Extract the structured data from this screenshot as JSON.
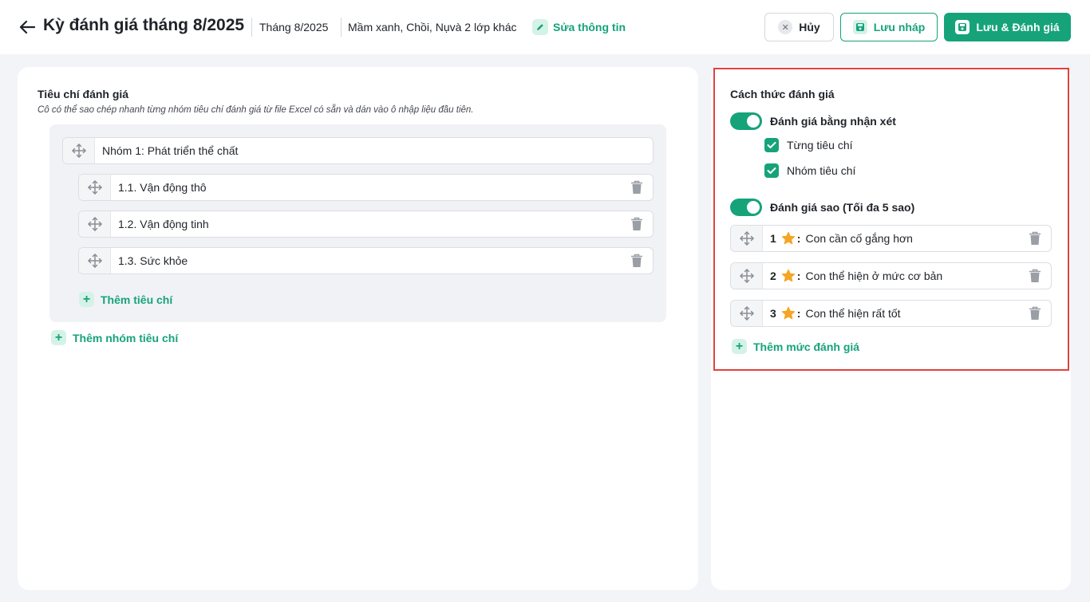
{
  "header": {
    "title": "Kỳ đánh giá tháng 8/2025",
    "month": "Tháng 8/2025",
    "classes": "Mầm xanh, Chồi, Nụvà 2 lớp khác",
    "edit_label": "Sửa thông tin",
    "cancel_label": "Hủy",
    "draft_label": "Lưu nháp",
    "save_label": "Lưu & Đánh giá"
  },
  "criteria": {
    "title": "Tiêu chí đánh giá",
    "hint": "Cô có thể sao chép nhanh từng nhóm tiêu chí đánh giá từ file Excel có sẵn và dán vào ô nhập liệu đầu tiên.",
    "groups": [
      {
        "name": "Nhóm 1: Phát triển thể chất",
        "items": [
          {
            "label": "1.1. Vận động thô"
          },
          {
            "label": "1.2. Vận động tinh"
          },
          {
            "label": "1.3. Sức khỏe"
          }
        ],
        "add_item_label": "Thêm tiêu chí"
      }
    ],
    "add_group_label": "Thêm nhóm tiêu chí"
  },
  "method": {
    "title": "Cách thức đánh giá",
    "comment_toggle": {
      "label": "Đánh giá bằng nhận xét",
      "on": true
    },
    "comment_options": [
      {
        "label": "Từng tiêu chí",
        "checked": true
      },
      {
        "label": "Nhóm tiêu chí",
        "checked": true
      }
    ],
    "star_toggle": {
      "label": "Đánh giá sao (Tối đa 5 sao)",
      "on": true
    },
    "levels": [
      {
        "number": "1",
        "colon": ":",
        "label": "Con cần cố gắng hơn"
      },
      {
        "number": "2",
        "colon": ":",
        "label": "Con thể hiện ở mức cơ bản"
      },
      {
        "number": "3",
        "colon": ":",
        "label": "Con thể hiện rất tốt"
      }
    ],
    "add_level_label": "Thêm mức đánh giá"
  },
  "colors": {
    "accent": "#16a37a",
    "highlight_border": "#e0433d",
    "star": "#f5a524"
  }
}
